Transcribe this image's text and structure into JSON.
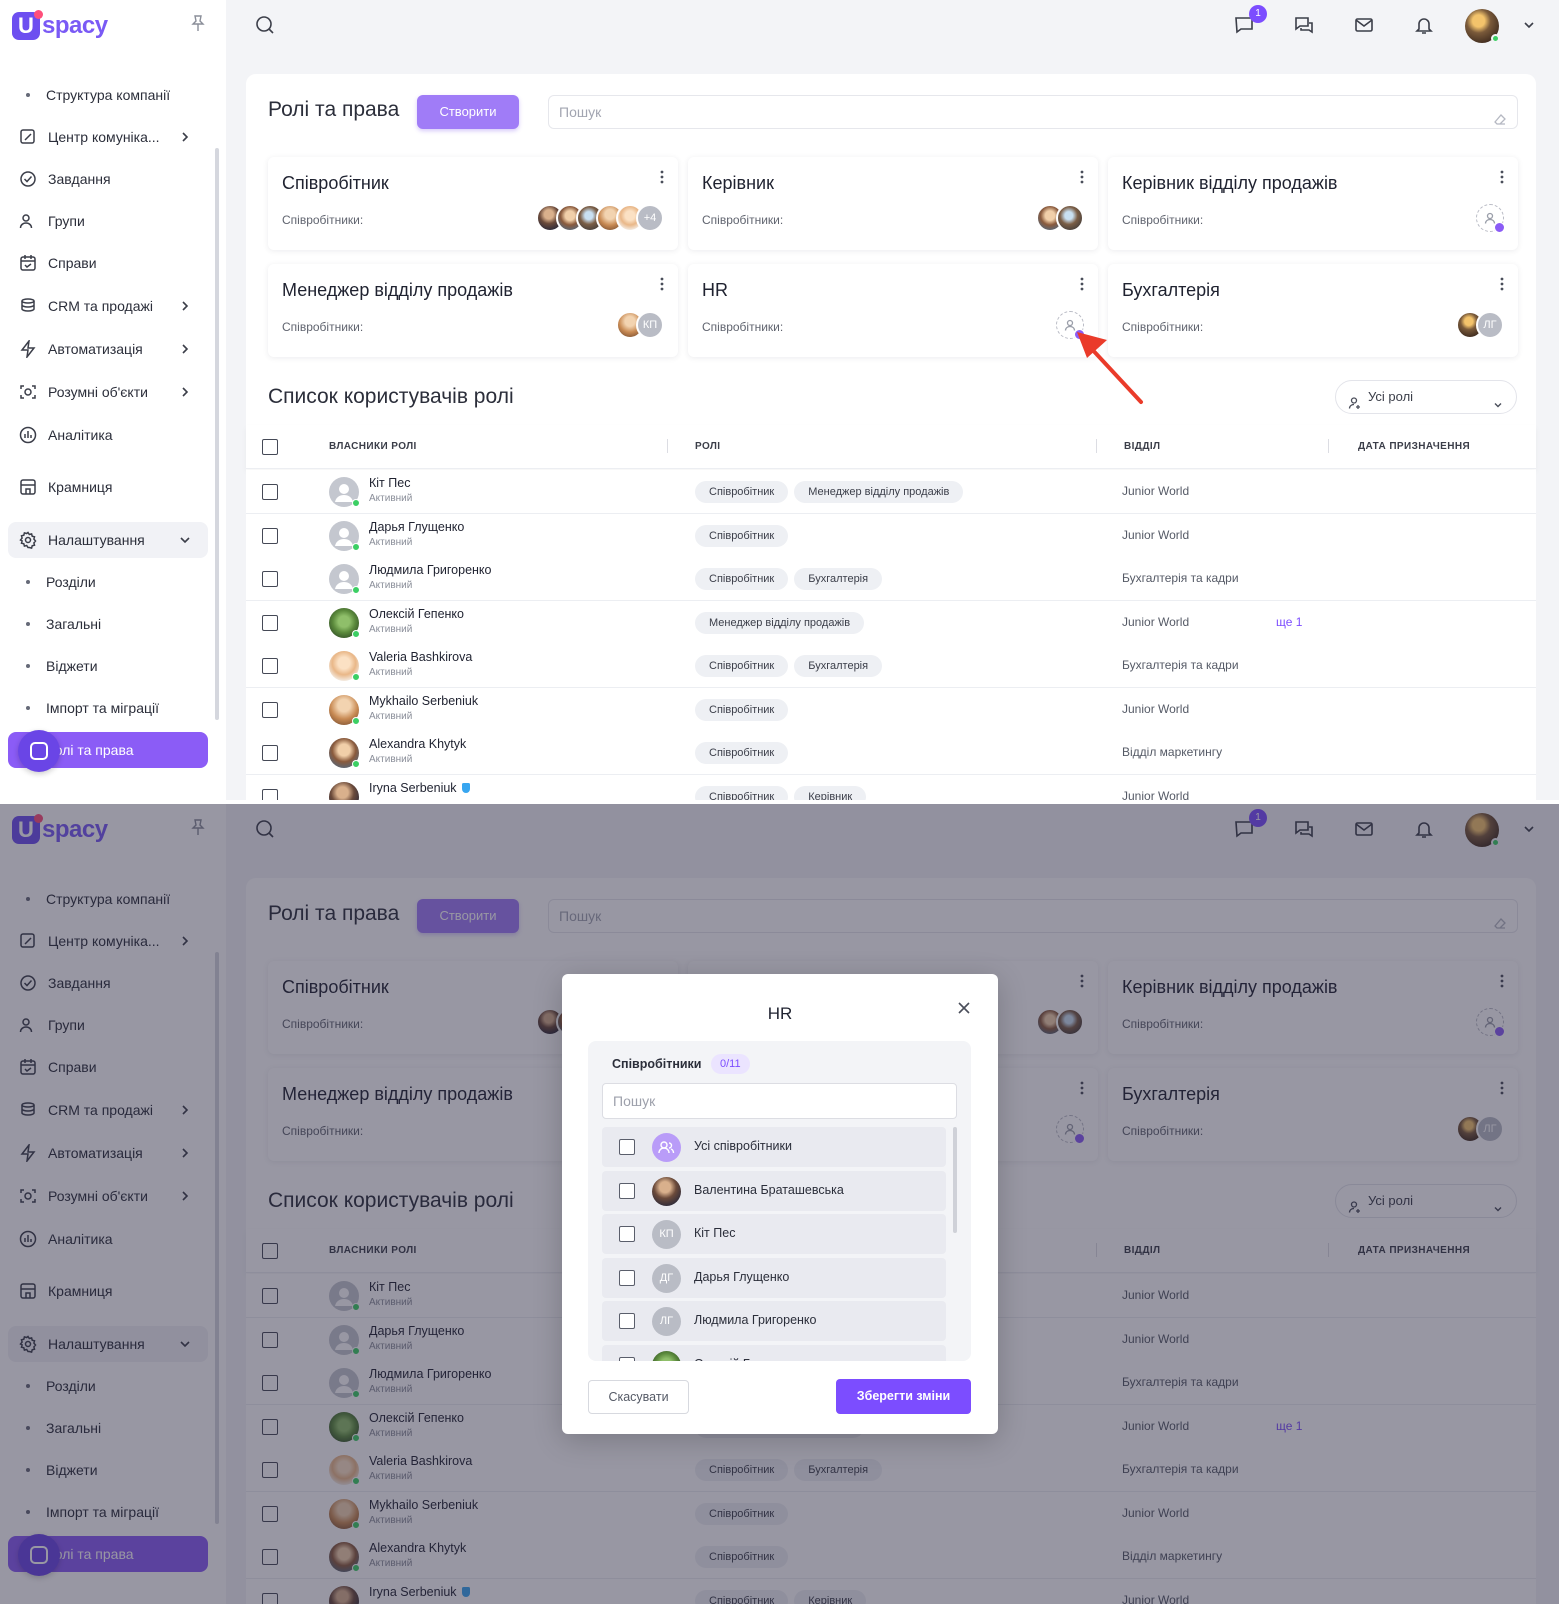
{
  "app": {
    "logo_letter": "U",
    "logo_text": "spacy"
  },
  "sidebar": {
    "items": [
      {
        "label": "Структура компанії",
        "type": "sub",
        "icon": "bullet"
      },
      {
        "label": "Центр комуніка...",
        "type": "main",
        "icon": "chat-edit-icon",
        "chevron": "right"
      },
      {
        "label": "Завдання",
        "type": "main",
        "icon": "check-circle-icon"
      },
      {
        "label": "Групи",
        "type": "main",
        "icon": "users-icon"
      },
      {
        "label": "Справи",
        "type": "main",
        "icon": "calendar-icon"
      },
      {
        "label": "CRM та продажі",
        "type": "main",
        "icon": "coins-icon",
        "chevron": "right"
      },
      {
        "label": "Автоматизація",
        "type": "main",
        "icon": "lightning-icon",
        "chevron": "right"
      },
      {
        "label": "Розумні об'єкти",
        "type": "main",
        "icon": "smart-object-icon",
        "chevron": "right"
      },
      {
        "label": "Аналітика",
        "type": "main",
        "icon": "analytics-icon"
      },
      {
        "label": "Крамниця",
        "type": "main",
        "icon": "store-icon"
      },
      {
        "label": "Налаштування",
        "type": "group",
        "icon": "gear-icon",
        "chevron": "down"
      },
      {
        "label": "Розділи",
        "type": "sub",
        "icon": "bullet"
      },
      {
        "label": "Загальні",
        "type": "sub",
        "icon": "bullet"
      },
      {
        "label": "Віджети",
        "type": "sub",
        "icon": "bullet"
      },
      {
        "label": "Імпорт та міграції",
        "type": "sub",
        "icon": "bullet"
      },
      {
        "label": "Ролі та права",
        "type": "active",
        "icon": "bullet"
      }
    ]
  },
  "topbar": {
    "notification_count": "1",
    "icons": [
      "search-icon",
      "messages-icon",
      "chats-icon",
      "mail-icon",
      "bell-icon",
      "avatar",
      "chevron-down-icon"
    ]
  },
  "page": {
    "title": "Ролі та права",
    "create_label": "Створити",
    "search_placeholder": "Пошук"
  },
  "roles": [
    {
      "title": "Співробітник",
      "employees_label": "Співробітники:",
      "avatars": [
        "photo",
        "photo",
        "photo",
        "photo",
        "photo"
      ],
      "extra": "+4"
    },
    {
      "title": "Керівник",
      "employees_label": "Співробітники:",
      "avatars": [
        "photo",
        "photo"
      ]
    },
    {
      "title": "Керівник відділу продажів",
      "employees_label": "Співробітники:",
      "avatars": [
        "add"
      ]
    },
    {
      "title": "Менеджер відділу продажів",
      "employees_label": "Співробітники:",
      "avatars": [
        "photo"
      ],
      "initials": "КП"
    },
    {
      "title": "HR",
      "employees_label": "Співробітники:",
      "avatars": [
        "add"
      ]
    },
    {
      "title": "Бухгалтерія",
      "employees_label": "Співробітники:",
      "avatars": [
        "photo"
      ],
      "initials": "ЛГ"
    }
  ],
  "user_list": {
    "title": "Список користувачів ролі",
    "filter_label": "Усі ролі",
    "columns": [
      "ВЛАСНИКИ РОЛІ",
      "РОЛІ",
      "ВІДДІЛ",
      "ДАТА ПРИЗНАЧЕННЯ"
    ],
    "rows": [
      {
        "name": "Кіт Пес",
        "status": "Активний",
        "roles": [
          "Співробітник",
          "Менеджер відділу продажів"
        ],
        "dept": "Junior World",
        "more": ""
      },
      {
        "name": "Дарья Глущенко",
        "status": "Активний",
        "roles": [
          "Співробітник"
        ],
        "dept": "Junior World",
        "more": ""
      },
      {
        "name": "Людмила Григоренко",
        "status": "Активний",
        "roles": [
          "Співробітник",
          "Бухгалтерія"
        ],
        "dept": "Бухгалтерія та кадри",
        "more": ""
      },
      {
        "name": "Олексій Гепенко",
        "status": "Активний",
        "roles": [
          "Менеджер відділу продажів"
        ],
        "dept": "Junior World",
        "more": "ще 1"
      },
      {
        "name": "Valeria Bashkirova",
        "status": "Активний",
        "roles": [
          "Співробітник",
          "Бухгалтерія"
        ],
        "dept": "Бухгалтерія та кадри",
        "more": ""
      },
      {
        "name": "Mykhailo Serbeniuk",
        "status": "Активний",
        "roles": [
          "Співробітник"
        ],
        "dept": "Junior World",
        "more": ""
      },
      {
        "name": "Alexandra Khytyk",
        "status": "Активний",
        "roles": [
          "Співробітник"
        ],
        "dept": "Відділ маркетингу",
        "more": ""
      },
      {
        "name": "Iryna Serbeniuk",
        "status": "",
        "roles": [
          "Співробітник",
          "Керівник"
        ],
        "dept": "Junior World",
        "more": ""
      }
    ]
  },
  "modal": {
    "title": "HR",
    "employees_label": "Співробітники",
    "count": "0/11",
    "search_placeholder": "Пошук",
    "items": [
      {
        "name": "Усі співробітники",
        "avatar": "group"
      },
      {
        "name": "Валентина Браташевська",
        "avatar": "photo"
      },
      {
        "name": "Кіт Пес",
        "avatar": "КП"
      },
      {
        "name": "Дарья Глущенко",
        "avatar": "ДГ"
      },
      {
        "name": "Людмила Григоренко",
        "avatar": "ЛГ"
      },
      {
        "name": "Олексій Г...",
        "avatar": "photo"
      }
    ],
    "cancel_label": "Скасувати",
    "save_label": "Зберегти зміни"
  },
  "colors": {
    "accent": "#7c4dff",
    "accent_light": "#a07cf7",
    "online": "#3ccf64",
    "annotation_arrow": "#ea3b2a"
  }
}
